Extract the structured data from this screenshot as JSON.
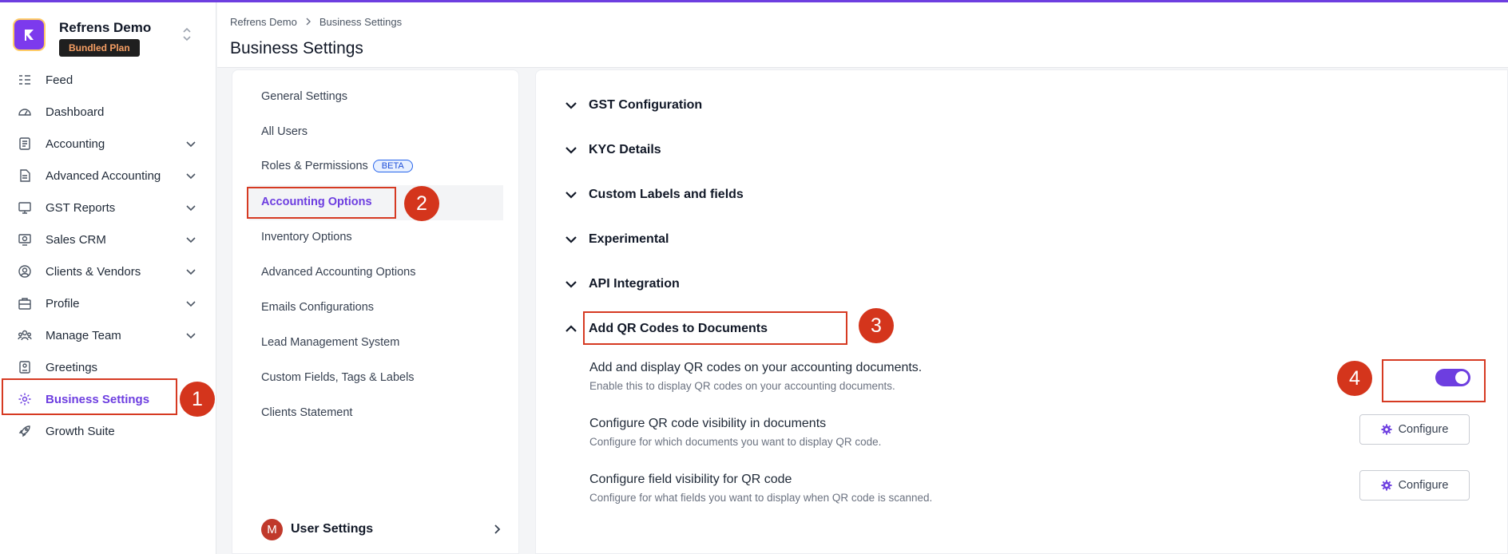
{
  "brand": {
    "name": "Refrens Demo",
    "plan": "Bundled Plan",
    "accent": "#6d3ee0"
  },
  "sidebar": {
    "items": [
      {
        "label": "Feed",
        "icon": "feed-icon",
        "has_children": false
      },
      {
        "label": "Dashboard",
        "icon": "dashboard-icon",
        "has_children": false
      },
      {
        "label": "Accounting",
        "icon": "accounting-icon",
        "has_children": true
      },
      {
        "label": "Advanced Accounting",
        "icon": "advanced-accounting-icon",
        "has_children": true
      },
      {
        "label": "GST Reports",
        "icon": "gst-icon",
        "has_children": true
      },
      {
        "label": "Sales CRM",
        "icon": "crm-icon",
        "has_children": true
      },
      {
        "label": "Clients & Vendors",
        "icon": "clients-icon",
        "has_children": true
      },
      {
        "label": "Profile",
        "icon": "profile-icon",
        "has_children": true
      },
      {
        "label": "Manage Team",
        "icon": "team-icon",
        "has_children": true
      },
      {
        "label": "Greetings",
        "icon": "greetings-icon",
        "has_children": false
      },
      {
        "label": "Business Settings",
        "icon": "gear-icon",
        "has_children": false,
        "active": true
      },
      {
        "label": "Growth Suite",
        "icon": "rocket-icon",
        "has_children": false
      }
    ]
  },
  "header": {
    "breadcrumb": [
      "Refrens Demo",
      "Business Settings"
    ],
    "title": "Business Settings"
  },
  "settings_menu": {
    "items": [
      {
        "label": "General Settings"
      },
      {
        "label": "All Users"
      },
      {
        "label": "Roles & Permissions",
        "badge": "BETA"
      },
      {
        "label": "Accounting Options",
        "active": true
      },
      {
        "label": "Inventory Options"
      },
      {
        "label": "Advanced Accounting Options"
      },
      {
        "label": "Emails Configurations"
      },
      {
        "label": "Lead Management System"
      },
      {
        "label": "Custom Fields, Tags & Labels"
      },
      {
        "label": "Clients Statement"
      }
    ],
    "user_settings": {
      "avatar": "M",
      "label": "User Settings"
    }
  },
  "content": {
    "sections": [
      {
        "label": "GST Configuration",
        "expanded": false
      },
      {
        "label": "KYC Details",
        "expanded": false
      },
      {
        "label": "Custom Labels and fields",
        "expanded": false
      },
      {
        "label": "Experimental",
        "expanded": false
      },
      {
        "label": "API Integration",
        "expanded": false
      },
      {
        "label": "Add QR Codes to Documents",
        "expanded": true
      }
    ],
    "qr_options": [
      {
        "title": "Add and display QR codes on your accounting documents.",
        "desc": "Enable this to display QR codes on your accounting documents.",
        "control": "toggle",
        "enabled": true
      },
      {
        "title": "Configure QR code visibility in documents",
        "desc": "Configure for which documents you want to display QR code.",
        "control": "button",
        "button_label": "Configure"
      },
      {
        "title": "Configure field visibility for QR code",
        "desc": "Configure for what fields you want to display when QR code is scanned.",
        "control": "button",
        "button_label": "Configure"
      }
    ]
  },
  "annotations": {
    "step1": "1",
    "step2": "2",
    "step3": "3",
    "step4": "4",
    "color": "#d4351c"
  }
}
